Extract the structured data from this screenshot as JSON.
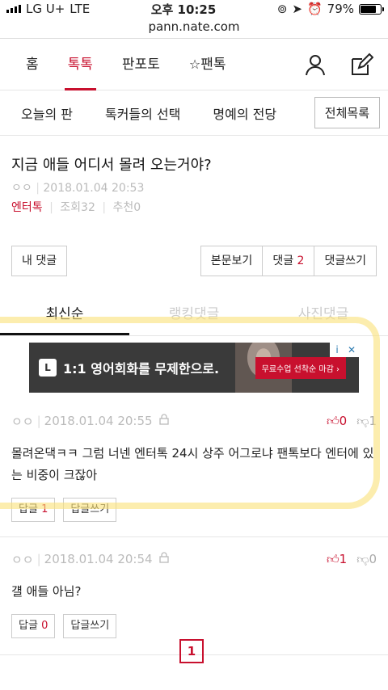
{
  "status": {
    "carrier": "LG U+",
    "network": "LTE",
    "time": "오후 10:25",
    "battery": "79%"
  },
  "browser": {
    "url": "pann.nate.com"
  },
  "nav": {
    "items": [
      "홈",
      "톡톡",
      "판포토",
      "팬톡"
    ],
    "active": "톡톡"
  },
  "subnav": {
    "items": [
      "오늘의 판",
      "톡커들의 선택",
      "명예의 전당"
    ],
    "all_label": "전체목록"
  },
  "post": {
    "title": "지금 애들 어디서 몰려 오는거야?",
    "author": "ㅇㅇ",
    "date": "2018.01.04 20:53",
    "category": "엔터톡",
    "views_label": "조회",
    "views": "32",
    "recommend_label": "추천",
    "recommend": "0"
  },
  "buttons": {
    "my_comments": "내 댓글",
    "view_post": "본문보기",
    "comments": "댓글",
    "comments_count": "2",
    "write_comment": "댓글쓰기"
  },
  "tabs": [
    "최신순",
    "랭킹댓글",
    "사진댓글"
  ],
  "ad": {
    "logo": "L",
    "text": "1:1 영어회화를 무제한으로.",
    "cta": "무료수업 선착순 마감 ›",
    "info": "i",
    "close": "✕"
  },
  "comments": [
    {
      "author": "ㅇㅇ",
      "date": "2018.01.04 20:55",
      "text": "몰려온댁ㅋㅋ 그럼 너넨 엔터톡 24시 상주 어그로냐 팬톡보다 엔터에 있는 비중이 크잖아",
      "up": "0",
      "down": "1",
      "reply_label": "답글",
      "reply_count": "1",
      "write_reply": "답글쓰기"
    },
    {
      "author": "ㅇㅇ",
      "date": "2018.01.04 20:54",
      "text": "걜 애들 아님?",
      "up": "1",
      "down": "0",
      "reply_label": "답글",
      "reply_count": "0",
      "write_reply": "답글쓰기"
    }
  ],
  "pager": {
    "current": "1"
  }
}
